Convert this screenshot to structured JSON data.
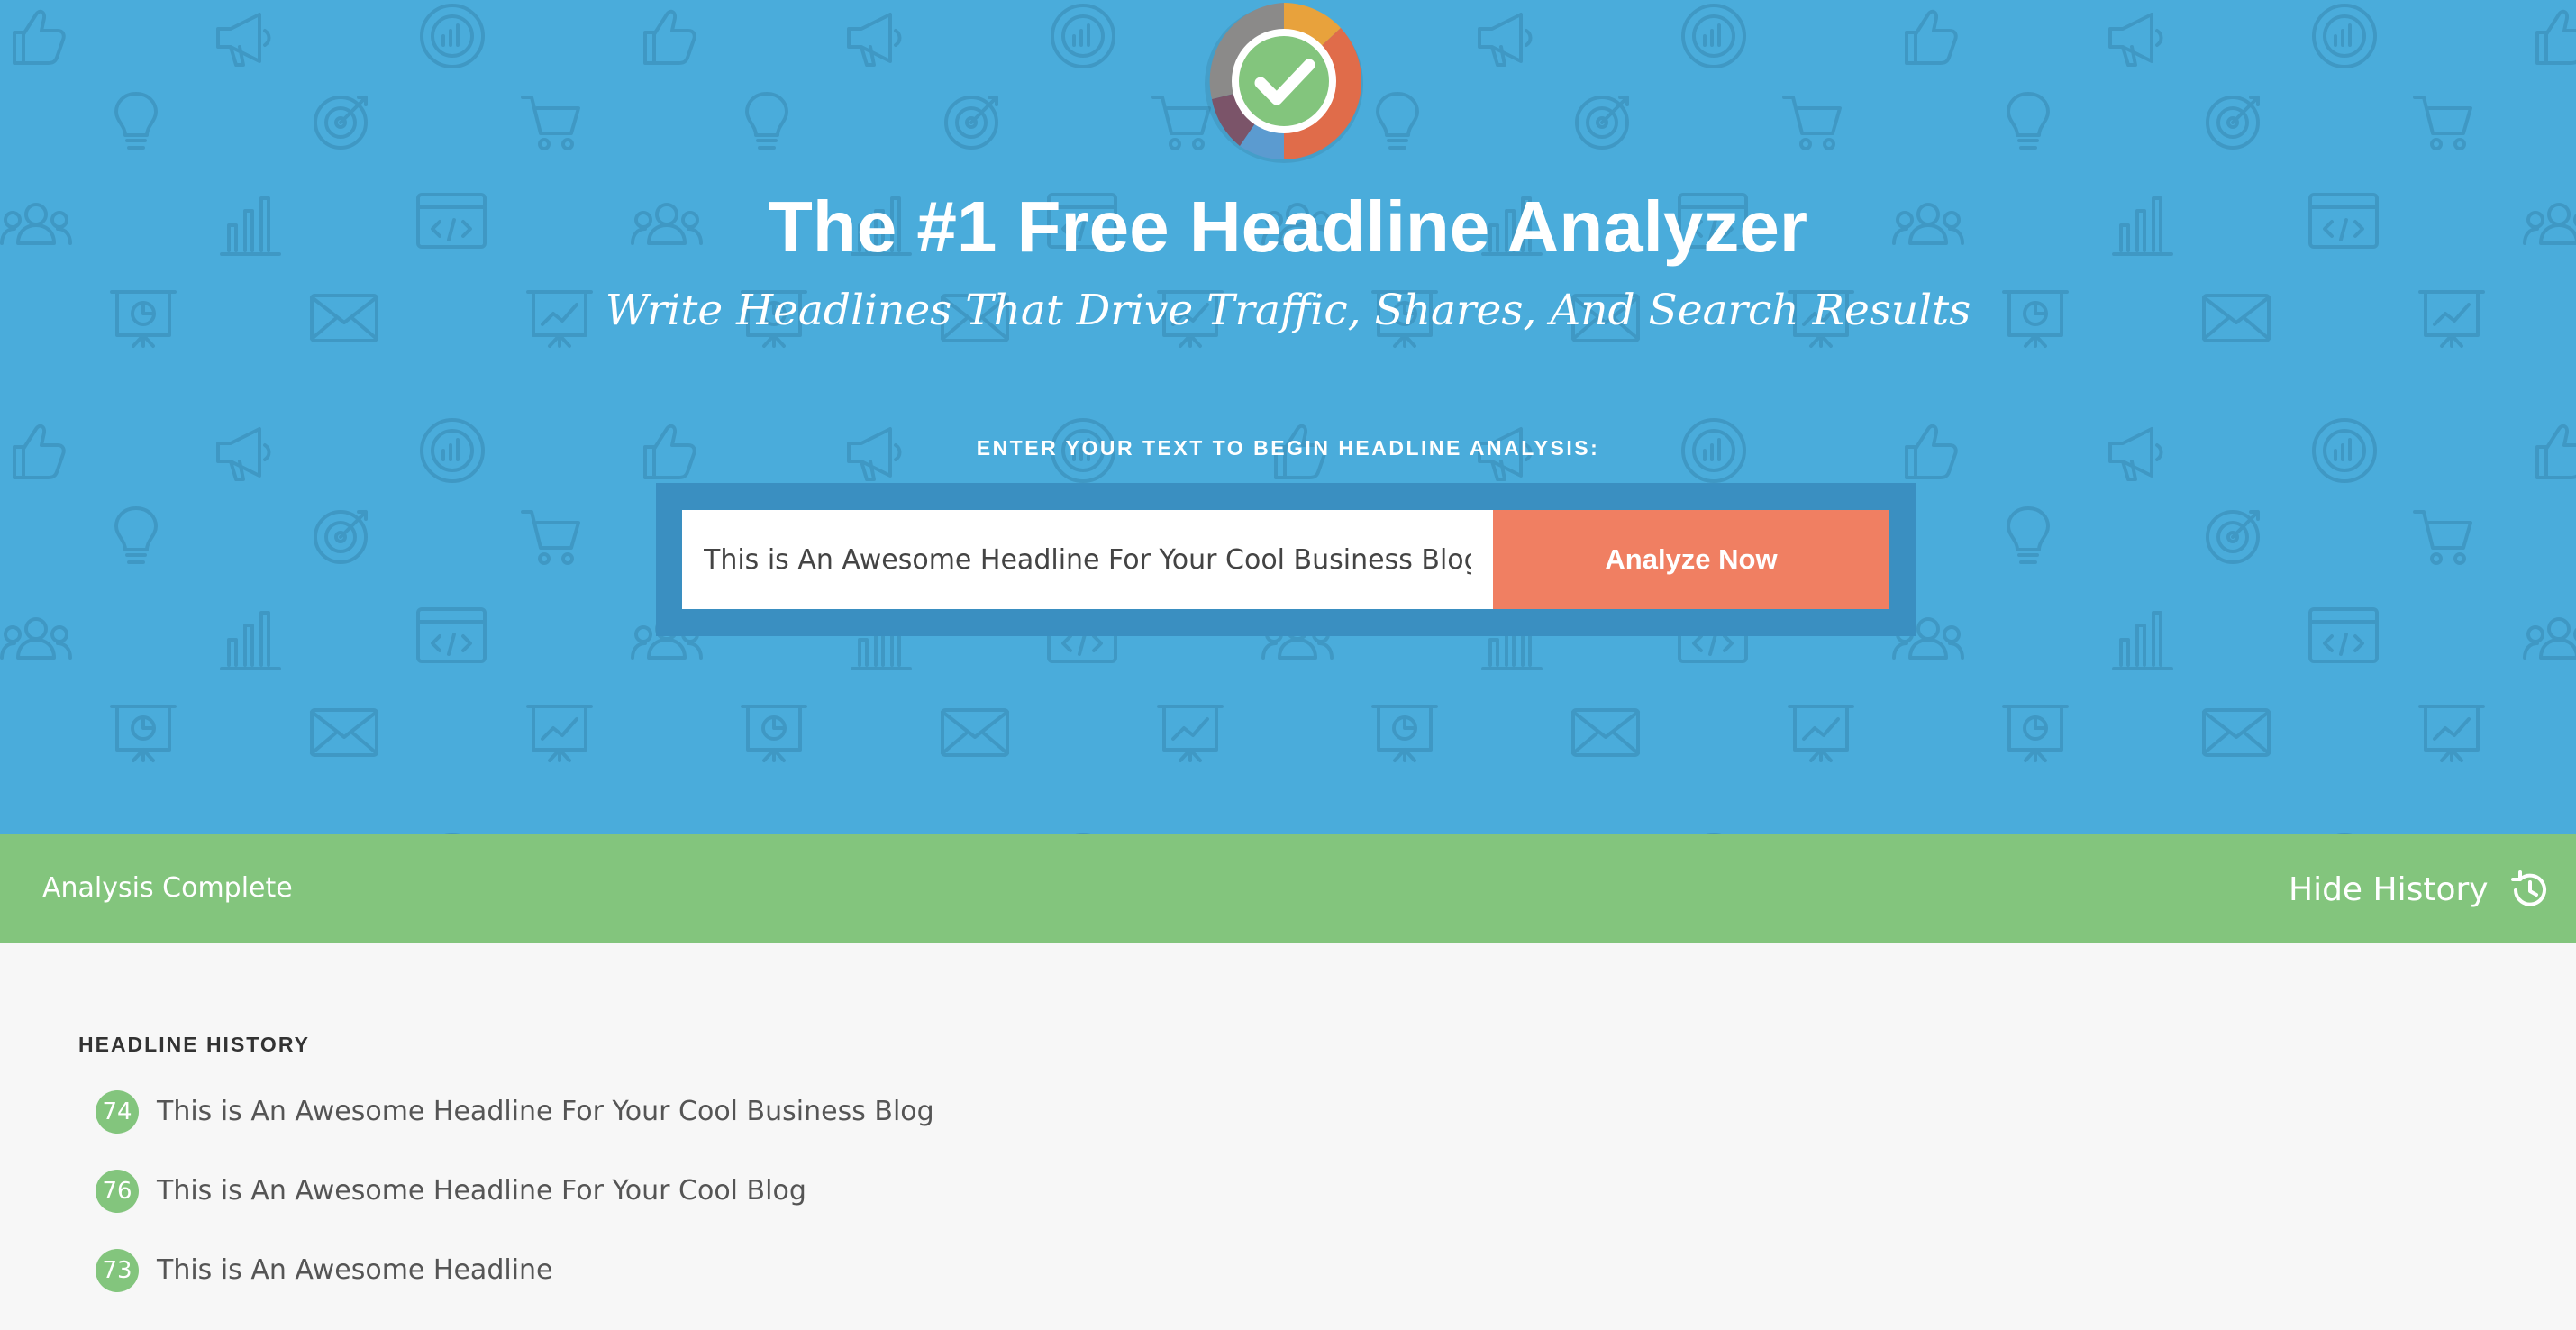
{
  "hero": {
    "title": "The #1 Free Headline Analyzer",
    "subtitle": "Write Headlines That Drive Traffic, Shares, And Search Results",
    "prompt": "ENTER YOUR TEXT TO BEGIN HEADLINE ANALYSIS:",
    "logo_icon": "checkmark-score-ring-icon",
    "background_pattern_icons": [
      "thumbs-up-icon",
      "megaphone-icon",
      "chart-target-icon",
      "lightbulb-icon",
      "target-icon",
      "shopping-cart-icon",
      "users-icon",
      "bar-chart-icon",
      "code-window-icon",
      "presentation-pie-icon",
      "envelope-icon",
      "presentation-trend-icon"
    ]
  },
  "form": {
    "input_value": "This is An Awesome Headline For Your Cool Business Blog",
    "button_label": "Analyze Now"
  },
  "status_bar": {
    "status_text": "Analysis Complete",
    "hide_history_label": "Hide History",
    "history_icon": "history-clock-icon"
  },
  "history": {
    "heading": "HEADLINE HISTORY",
    "items": [
      {
        "score": "74",
        "text": "This is An Awesome Headline For Your Cool Business Blog"
      },
      {
        "score": "76",
        "text": "This is An Awesome Headline For Your Cool Blog"
      },
      {
        "score": "73",
        "text": "This is An Awesome Headline"
      }
    ]
  },
  "colors": {
    "hero_background": "#4aacdb",
    "pattern_icon": "#3f98c4",
    "form_frame": "#3a8fc1",
    "button": "#f07f62",
    "status_bar": "#83c57d",
    "score_badge": "#83c57d",
    "content_background": "#f7f7f7"
  }
}
